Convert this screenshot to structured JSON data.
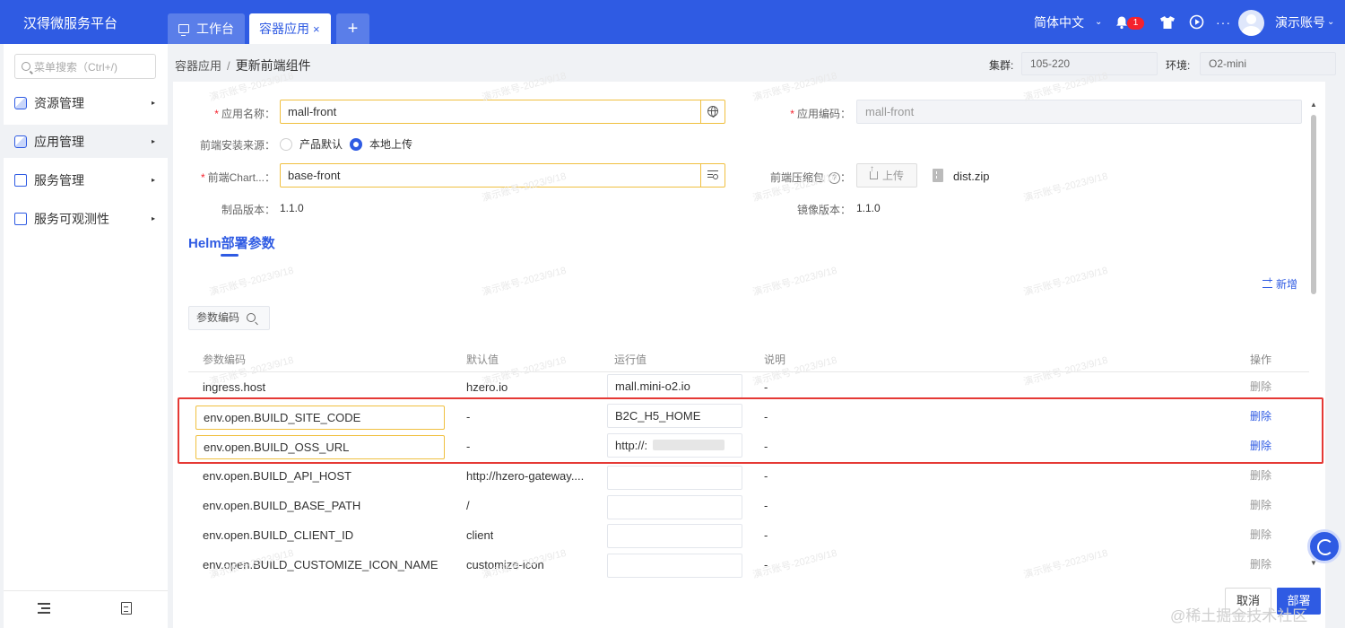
{
  "app": {
    "title": "汉得微服务平台"
  },
  "tabs": [
    {
      "label": "工作台"
    },
    {
      "label": "容器应用",
      "close": "×"
    },
    {
      "label": "+"
    }
  ],
  "header": {
    "language": "简体中文",
    "notification_count": "1",
    "user_name": "演示账号",
    "more": "···"
  },
  "sidebar": {
    "search_placeholder": "菜单搜索（Ctrl+/)",
    "items": [
      {
        "label": "资源管理"
      },
      {
        "label": "应用管理"
      },
      {
        "label": "服务管理"
      },
      {
        "label": "服务可观测性"
      }
    ]
  },
  "breadcrumb": {
    "parent": "容器应用",
    "sep": "/",
    "current": "更新前端组件"
  },
  "context": {
    "cluster_label": "集群:",
    "cluster_value": "105-220",
    "env_label": "环境:",
    "env_value": "O2-mini"
  },
  "form": {
    "app_name_label": "应用名称",
    "app_name_value": "mall-front",
    "app_code_label": "应用编码",
    "app_code_value": "mall-front",
    "source_label": "前端安装来源",
    "source_options": [
      "产品默认",
      "本地上传"
    ],
    "chart_label": "前端Chart...",
    "chart_value": "base-front",
    "package_label": "前端压缩包",
    "upload_label": "上传",
    "file_name": "dist.zip",
    "product_version_label": "制品版本",
    "product_version_value": "1.1.0",
    "image_version_label": "镜像版本",
    "image_version_value": "1.1.0",
    "colon": "："
  },
  "helm": {
    "title": "Helm部署参数",
    "add_label": "新增",
    "filter_label": "参数编码",
    "columns": [
      "参数编码",
      "默认值",
      "运行值",
      "说明",
      "操作"
    ],
    "rows": [
      {
        "code": "ingress.host",
        "default": "hzero.io",
        "run": "mall.mini-o2.io",
        "desc": "-",
        "action": "删除"
      },
      {
        "code": "env.open.BUILD_SITE_CODE",
        "default": "-",
        "run": "B2C_H5_HOME",
        "desc": "-",
        "action": "删除"
      },
      {
        "code": "env.open.BUILD_OSS_URL",
        "default": "-",
        "run": "http://:",
        "desc": "-",
        "action": "删除"
      },
      {
        "code": "env.open.BUILD_API_HOST",
        "default": "http://hzero-gateway....",
        "run": "",
        "desc": "-",
        "action": "删除"
      },
      {
        "code": "env.open.BUILD_BASE_PATH",
        "default": "/",
        "run": "",
        "desc": "-",
        "action": "删除"
      },
      {
        "code": "env.open.BUILD_CLIENT_ID",
        "default": "client",
        "run": "",
        "desc": "-",
        "action": "删除"
      },
      {
        "code": "env.open.BUILD_CUSTOMIZE_ICON_NAME",
        "default": "customize-icon",
        "run": "",
        "desc": "-",
        "action": "删除"
      }
    ]
  },
  "footer": {
    "cancel": "取消",
    "deploy": "部署"
  },
  "watermark": {
    "text": "演示账号-2023/9/18",
    "site": "@稀土掘金技术社区"
  },
  "colors": {
    "primary": "#2f5be3",
    "highlight": "#e53935",
    "required": "#f5222d",
    "focus_border": "#f0c040"
  }
}
